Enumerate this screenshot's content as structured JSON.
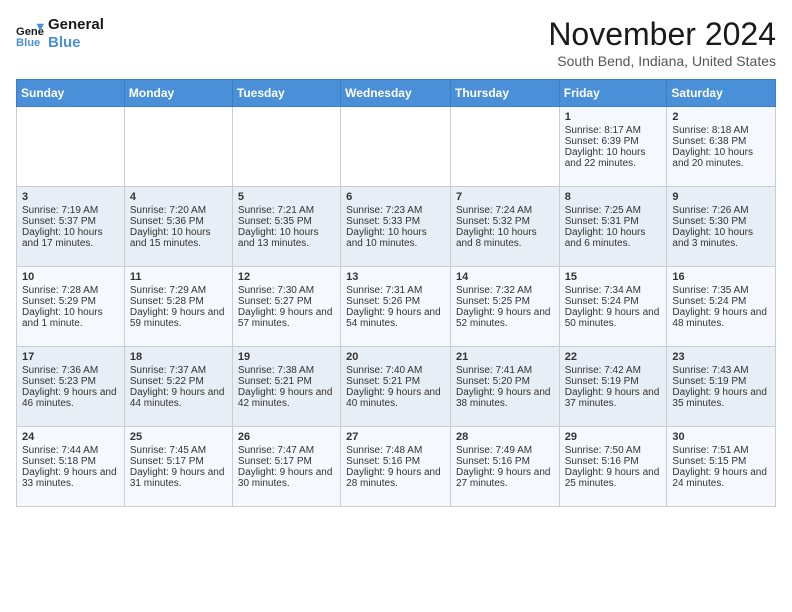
{
  "header": {
    "logo_line1": "General",
    "logo_line2": "Blue",
    "month": "November 2024",
    "location": "South Bend, Indiana, United States"
  },
  "days_of_week": [
    "Sunday",
    "Monday",
    "Tuesday",
    "Wednesday",
    "Thursday",
    "Friday",
    "Saturday"
  ],
  "weeks": [
    [
      {
        "day": "",
        "sunrise": "",
        "sunset": "",
        "daylight": ""
      },
      {
        "day": "",
        "sunrise": "",
        "sunset": "",
        "daylight": ""
      },
      {
        "day": "",
        "sunrise": "",
        "sunset": "",
        "daylight": ""
      },
      {
        "day": "",
        "sunrise": "",
        "sunset": "",
        "daylight": ""
      },
      {
        "day": "",
        "sunrise": "",
        "sunset": "",
        "daylight": ""
      },
      {
        "day": "1",
        "sunrise": "Sunrise: 8:17 AM",
        "sunset": "Sunset: 6:39 PM",
        "daylight": "Daylight: 10 hours and 22 minutes."
      },
      {
        "day": "2",
        "sunrise": "Sunrise: 8:18 AM",
        "sunset": "Sunset: 6:38 PM",
        "daylight": "Daylight: 10 hours and 20 minutes."
      }
    ],
    [
      {
        "day": "3",
        "sunrise": "Sunrise: 7:19 AM",
        "sunset": "Sunset: 5:37 PM",
        "daylight": "Daylight: 10 hours and 17 minutes."
      },
      {
        "day": "4",
        "sunrise": "Sunrise: 7:20 AM",
        "sunset": "Sunset: 5:36 PM",
        "daylight": "Daylight: 10 hours and 15 minutes."
      },
      {
        "day": "5",
        "sunrise": "Sunrise: 7:21 AM",
        "sunset": "Sunset: 5:35 PM",
        "daylight": "Daylight: 10 hours and 13 minutes."
      },
      {
        "day": "6",
        "sunrise": "Sunrise: 7:23 AM",
        "sunset": "Sunset: 5:33 PM",
        "daylight": "Daylight: 10 hours and 10 minutes."
      },
      {
        "day": "7",
        "sunrise": "Sunrise: 7:24 AM",
        "sunset": "Sunset: 5:32 PM",
        "daylight": "Daylight: 10 hours and 8 minutes."
      },
      {
        "day": "8",
        "sunrise": "Sunrise: 7:25 AM",
        "sunset": "Sunset: 5:31 PM",
        "daylight": "Daylight: 10 hours and 6 minutes."
      },
      {
        "day": "9",
        "sunrise": "Sunrise: 7:26 AM",
        "sunset": "Sunset: 5:30 PM",
        "daylight": "Daylight: 10 hours and 3 minutes."
      }
    ],
    [
      {
        "day": "10",
        "sunrise": "Sunrise: 7:28 AM",
        "sunset": "Sunset: 5:29 PM",
        "daylight": "Daylight: 10 hours and 1 minute."
      },
      {
        "day": "11",
        "sunrise": "Sunrise: 7:29 AM",
        "sunset": "Sunset: 5:28 PM",
        "daylight": "Daylight: 9 hours and 59 minutes."
      },
      {
        "day": "12",
        "sunrise": "Sunrise: 7:30 AM",
        "sunset": "Sunset: 5:27 PM",
        "daylight": "Daylight: 9 hours and 57 minutes."
      },
      {
        "day": "13",
        "sunrise": "Sunrise: 7:31 AM",
        "sunset": "Sunset: 5:26 PM",
        "daylight": "Daylight: 9 hours and 54 minutes."
      },
      {
        "day": "14",
        "sunrise": "Sunrise: 7:32 AM",
        "sunset": "Sunset: 5:25 PM",
        "daylight": "Daylight: 9 hours and 52 minutes."
      },
      {
        "day": "15",
        "sunrise": "Sunrise: 7:34 AM",
        "sunset": "Sunset: 5:24 PM",
        "daylight": "Daylight: 9 hours and 50 minutes."
      },
      {
        "day": "16",
        "sunrise": "Sunrise: 7:35 AM",
        "sunset": "Sunset: 5:24 PM",
        "daylight": "Daylight: 9 hours and 48 minutes."
      }
    ],
    [
      {
        "day": "17",
        "sunrise": "Sunrise: 7:36 AM",
        "sunset": "Sunset: 5:23 PM",
        "daylight": "Daylight: 9 hours and 46 minutes."
      },
      {
        "day": "18",
        "sunrise": "Sunrise: 7:37 AM",
        "sunset": "Sunset: 5:22 PM",
        "daylight": "Daylight: 9 hours and 44 minutes."
      },
      {
        "day": "19",
        "sunrise": "Sunrise: 7:38 AM",
        "sunset": "Sunset: 5:21 PM",
        "daylight": "Daylight: 9 hours and 42 minutes."
      },
      {
        "day": "20",
        "sunrise": "Sunrise: 7:40 AM",
        "sunset": "Sunset: 5:21 PM",
        "daylight": "Daylight: 9 hours and 40 minutes."
      },
      {
        "day": "21",
        "sunrise": "Sunrise: 7:41 AM",
        "sunset": "Sunset: 5:20 PM",
        "daylight": "Daylight: 9 hours and 38 minutes."
      },
      {
        "day": "22",
        "sunrise": "Sunrise: 7:42 AM",
        "sunset": "Sunset: 5:19 PM",
        "daylight": "Daylight: 9 hours and 37 minutes."
      },
      {
        "day": "23",
        "sunrise": "Sunrise: 7:43 AM",
        "sunset": "Sunset: 5:19 PM",
        "daylight": "Daylight: 9 hours and 35 minutes."
      }
    ],
    [
      {
        "day": "24",
        "sunrise": "Sunrise: 7:44 AM",
        "sunset": "Sunset: 5:18 PM",
        "daylight": "Daylight: 9 hours and 33 minutes."
      },
      {
        "day": "25",
        "sunrise": "Sunrise: 7:45 AM",
        "sunset": "Sunset: 5:17 PM",
        "daylight": "Daylight: 9 hours and 31 minutes."
      },
      {
        "day": "26",
        "sunrise": "Sunrise: 7:47 AM",
        "sunset": "Sunset: 5:17 PM",
        "daylight": "Daylight: 9 hours and 30 minutes."
      },
      {
        "day": "27",
        "sunrise": "Sunrise: 7:48 AM",
        "sunset": "Sunset: 5:16 PM",
        "daylight": "Daylight: 9 hours and 28 minutes."
      },
      {
        "day": "28",
        "sunrise": "Sunrise: 7:49 AM",
        "sunset": "Sunset: 5:16 PM",
        "daylight": "Daylight: 9 hours and 27 minutes."
      },
      {
        "day": "29",
        "sunrise": "Sunrise: 7:50 AM",
        "sunset": "Sunset: 5:16 PM",
        "daylight": "Daylight: 9 hours and 25 minutes."
      },
      {
        "day": "30",
        "sunrise": "Sunrise: 7:51 AM",
        "sunset": "Sunset: 5:15 PM",
        "daylight": "Daylight: 9 hours and 24 minutes."
      }
    ]
  ]
}
